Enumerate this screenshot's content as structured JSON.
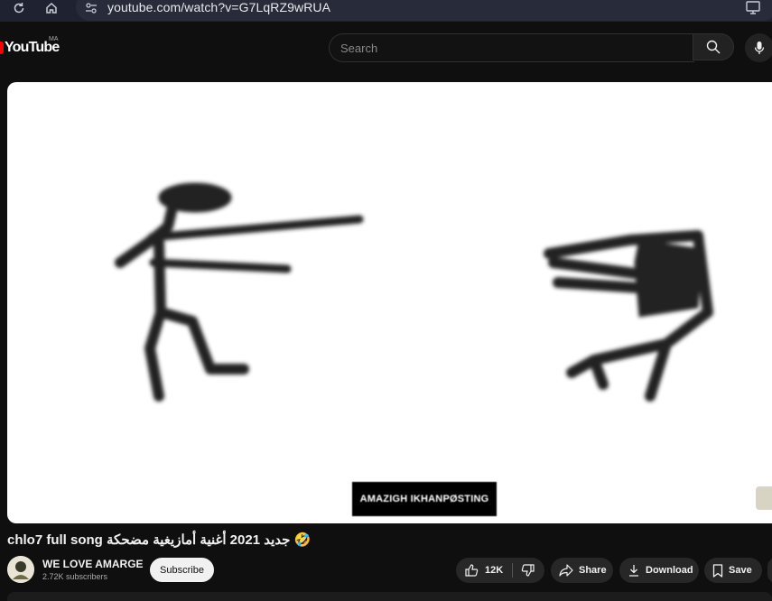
{
  "browser": {
    "url": "youtube.com/watch?v=G7LqRZ9wRUA"
  },
  "header": {
    "logo_text": "YouTube",
    "country_code": "MA",
    "search_placeholder": "Search"
  },
  "video": {
    "watermark_text": "AMAZIGH IKHANPØSTING",
    "title": "chlo7 full song جديد 2021 أغنية أمازيغية مضحكة 🤣"
  },
  "channel": {
    "name": "WE LOVE AMARGE",
    "subscribers": "2.72K subscribers",
    "subscribe_label": "Subscribe"
  },
  "actions": {
    "like_count": "12K",
    "share_label": "Share",
    "download_label": "Download",
    "save_label": "Save"
  },
  "icons": [
    "reload-icon",
    "home-icon",
    "tune-icon",
    "cast-icon",
    "search-icon",
    "mic-icon",
    "like-icon",
    "dislike-icon",
    "share-icon",
    "download-icon",
    "save-icon"
  ],
  "colors": {
    "brand_red": "#ff0000",
    "background": "#0f0f0f",
    "pill": "#272727"
  }
}
